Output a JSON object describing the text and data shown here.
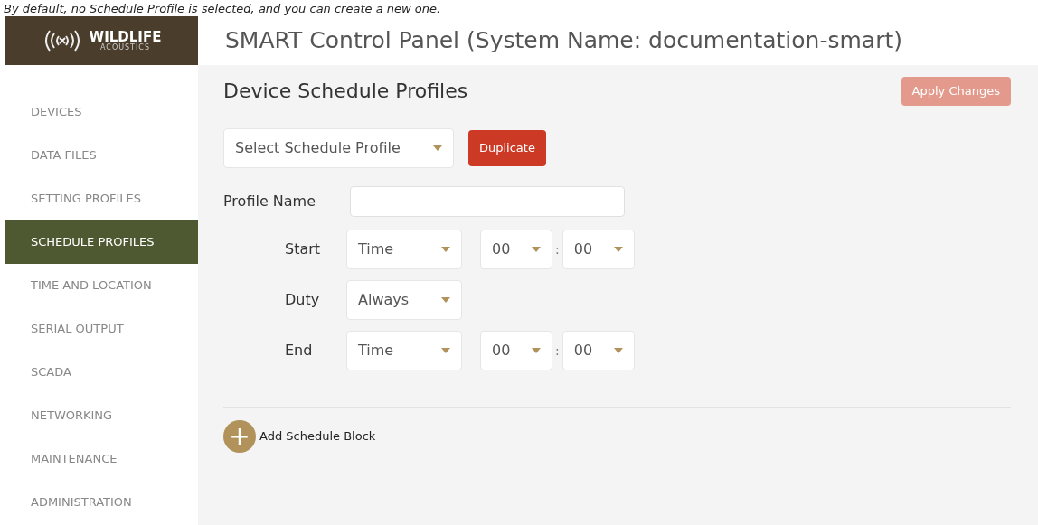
{
  "caption": "By default, no Schedule Profile is selected, and you can create a new one.",
  "logo": {
    "name": "WILDLIFE",
    "sub": "ACOUSTICS"
  },
  "header": {
    "title": "SMART Control Panel  (System Name:  documentation-smart)"
  },
  "sidebar": {
    "items": [
      {
        "label": "DEVICES",
        "selected": false
      },
      {
        "label": "DATA FILES",
        "selected": false
      },
      {
        "label": "SETTING PROFILES",
        "selected": false
      },
      {
        "label": "SCHEDULE PROFILES",
        "selected": true
      },
      {
        "label": "TIME AND LOCATION",
        "selected": false
      },
      {
        "label": "SERIAL OUTPUT",
        "selected": false
      },
      {
        "label": "SCADA",
        "selected": false
      },
      {
        "label": "NETWORKING",
        "selected": false
      },
      {
        "label": "MAINTENANCE",
        "selected": false
      },
      {
        "label": "ADMINISTRATION",
        "selected": false
      }
    ]
  },
  "page": {
    "title": "Device Schedule Profiles",
    "apply_button": {
      "label": "Apply Changes",
      "disabled": true
    },
    "profile_select": {
      "value": "Select Schedule Profile"
    },
    "duplicate_button": "Duplicate",
    "profile_name": {
      "label": "Profile Name"
    },
    "schedule_rows": [
      {
        "kind": "time",
        "label": "Start",
        "type": "Time",
        "hour": "00",
        "separator": ":",
        "minute": "00"
      },
      {
        "kind": "select",
        "label": "Duty",
        "type": "Always"
      },
      {
        "kind": "time",
        "label": "End",
        "type": "Time",
        "hour": "00",
        "separator": ":",
        "minute": "00"
      }
    ],
    "add_block": {
      "icon": "+",
      "label": "Add Schedule Block"
    }
  }
}
